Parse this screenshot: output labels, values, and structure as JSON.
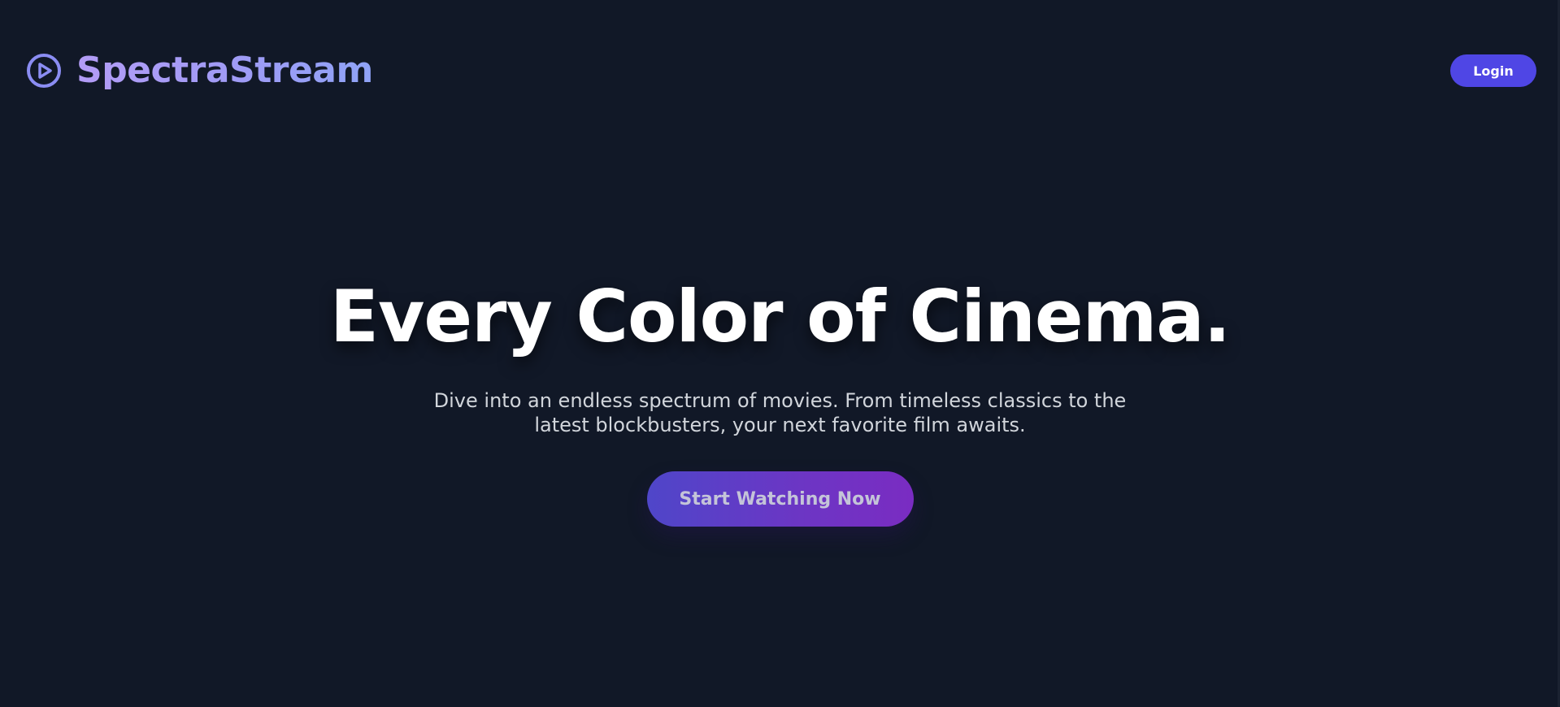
{
  "colors": {
    "background": "#111827",
    "accent": "#4f46e5",
    "brand_gradient_start": "#b39cf6",
    "brand_gradient_end": "#8fa3f7",
    "cta_gradient_start": "#4f46c9",
    "cta_gradient_end": "#7a2cc2"
  },
  "header": {
    "logo_icon": "play-circle-icon",
    "brand_name": "SpectraStream",
    "login_label": "Login"
  },
  "hero": {
    "headline": "Every Color of Cinema.",
    "subheadline": "Dive into an endless spectrum of movies. From timeless classics to the latest blockbusters, your next favorite film awaits.",
    "cta_label": "Start Watching Now"
  }
}
